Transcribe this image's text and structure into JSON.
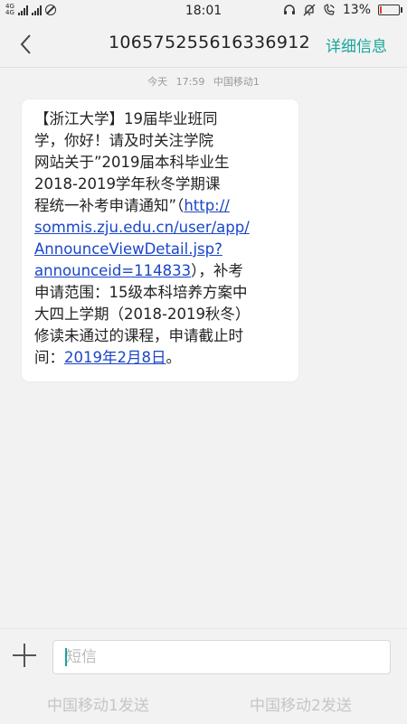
{
  "status_bar": {
    "network": "4G",
    "network2": "4G",
    "time": "18:01",
    "battery": "13%",
    "battery_level": 0.13,
    "icons": [
      "signal-icon",
      "do-not-disturb-icon",
      "headset-icon",
      "mute-bell-icon",
      "wifi-call-icon",
      "battery-icon"
    ]
  },
  "header": {
    "back_icon": "chevron-left-icon",
    "title": "10657525561633691 2",
    "detail_label": "详细信息"
  },
  "timestamp": {
    "day": "今天",
    "time": "17:59",
    "carrier": "中国移动1"
  },
  "message": {
    "lines": [
      "【浙江大学】19届毕业班同",
      "学，你好！请及时关注学院",
      "网站关于”2019届本科毕业生",
      "2018-2019学年秋冬学期课"
    ],
    "line5_text": "程统一补考申请通知”（",
    "link_part1": "http://",
    "link_part2": "sommis.zju.edu.cn/user/app/",
    "link_part3": "AnnounceViewDetail.jsp?",
    "link_part4": "announceid=114833",
    "after_link": "），补考",
    "lines2": [
      "申请范围：15级本科培养方案中",
      "大四上学期（2018-2019秋冬）",
      "修读未通过的课程，申请截止时"
    ],
    "last_prefix": "间：",
    "date_link": "2019年2月8日",
    "last_suffix": "。",
    "link_color": "#1a46c8"
  },
  "input": {
    "placeholder": "短信",
    "value": ""
  },
  "send_buttons": {
    "send1": "中国移动1发送",
    "send2": "中国移动2发送"
  },
  "colors": {
    "accent": "#1aa59a",
    "background": "#f2f2f2",
    "bubble": "#ffffff",
    "battery_low": "#e53935"
  }
}
